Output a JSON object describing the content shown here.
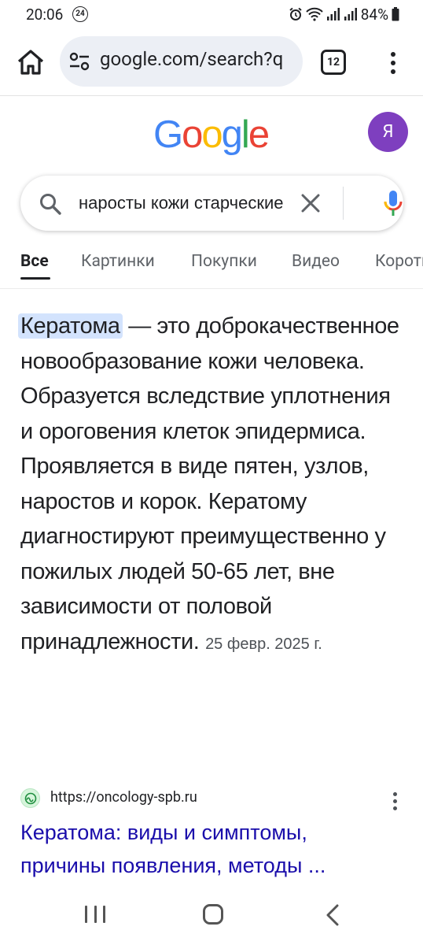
{
  "status_bar": {
    "time": "20:06",
    "badge": "24",
    "battery": "84%"
  },
  "toolbar": {
    "url": "google.com/search?q",
    "tab_count": "12"
  },
  "logo": [
    "G",
    "o",
    "o",
    "g",
    "l",
    "e"
  ],
  "logo_colors": [
    "#4285F4",
    "#EA4335",
    "#FBBC05",
    "#4285F4",
    "#34A853",
    "#EA4335"
  ],
  "avatar": {
    "initial": "Я",
    "color": "#7e3fbf"
  },
  "search": {
    "query": "наросты кожи старческие"
  },
  "tabs": [
    "Все",
    "Картинки",
    "Покупки",
    "Видео",
    "Короткие видео"
  ],
  "snippet": {
    "highlight": "Кератома",
    "text": " — это доброкачественное новообразование кожи человека. Образуется вследствие уплотнения и ороговения клеток эпидермиса. Проявляется в виде пятен, узлов, наростов и корок. Кератому диагностируют преимущественно у пожилых людей 50-65 лет, вне зависимости от половой принадлежности. ",
    "date": "25 февр. 2025 г."
  },
  "result": {
    "url": "https://oncology-spb.ru",
    "title": "Кератома: виды и симптомы, причины появления, методы ..."
  },
  "colors": {
    "link": "#1a0dab",
    "highlight": "#d3e3fd"
  }
}
